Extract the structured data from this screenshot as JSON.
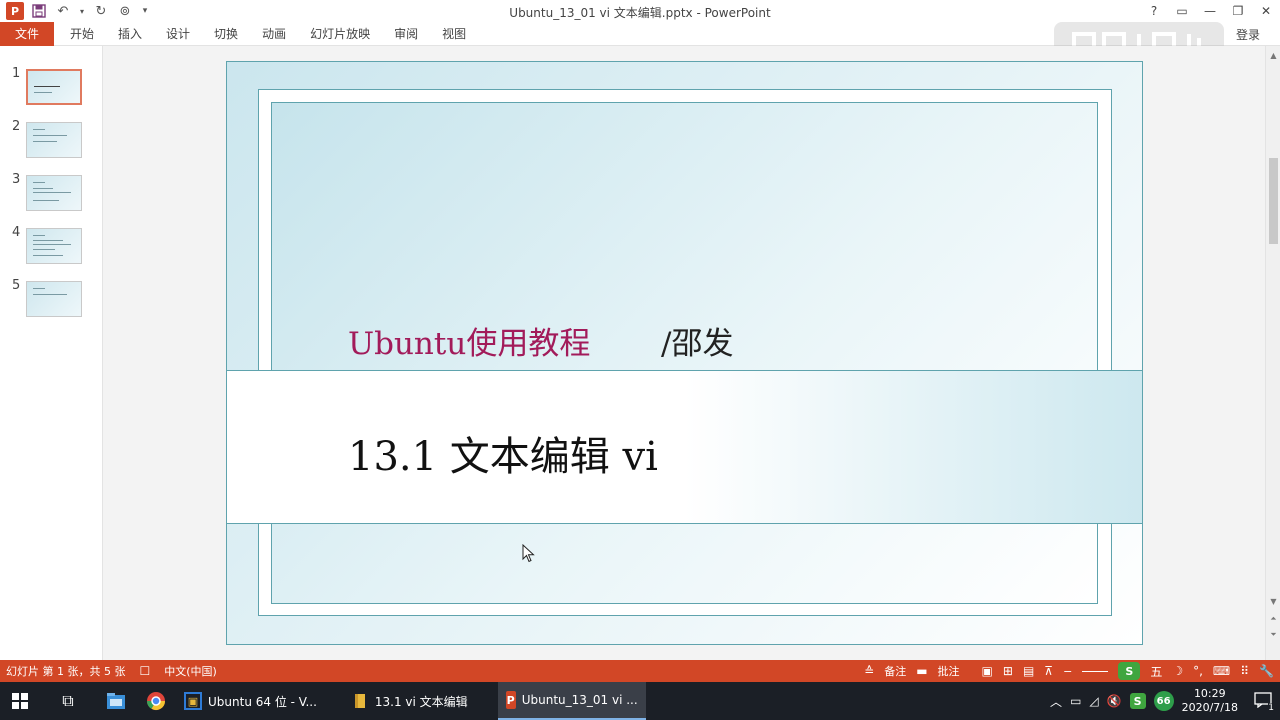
{
  "window": {
    "title": "Ubuntu_13_01 vi 文本编辑.pptx - PowerPoint",
    "login": "登录",
    "controls": [
      "?",
      "▭",
      "—",
      "❐",
      "✕"
    ]
  },
  "ribbon": {
    "file_tab": "文件",
    "tabs": [
      "开始",
      "插入",
      "设计",
      "切换",
      "动画",
      "幻灯片放映",
      "审阅",
      "视图"
    ]
  },
  "thumbnails": [
    {
      "number": "1",
      "selected": true
    },
    {
      "number": "2",
      "selected": false
    },
    {
      "number": "3",
      "selected": false
    },
    {
      "number": "4",
      "selected": false
    },
    {
      "number": "5",
      "selected": false
    }
  ],
  "slide": {
    "subtitle": "Ubuntu使用教程",
    "author": "/邵发",
    "title": "13.1 文本编辑 vi"
  },
  "statusbar": {
    "slide_info": "幻灯片 第 1 张，共 5 张",
    "language": "中文(中国)",
    "notes": "备注",
    "comments": "批注"
  },
  "taskbar": {
    "apps": [
      {
        "label": "Ubuntu 64 位 - V...",
        "icon": "VM",
        "color": "#2e7bd6",
        "active": false
      },
      {
        "label": "13.1 vi 文本编辑",
        "icon": "📁",
        "color": "#e8b83c",
        "active": false
      },
      {
        "label": "Ubuntu_13_01 vi ...",
        "icon": "P",
        "color": "#d24726",
        "active": true
      }
    ],
    "tray_badge": "66",
    "time": "10:29",
    "date": "2020/7/18",
    "notification_count": "1"
  },
  "colors": {
    "accent": "#d24726",
    "slide_border": "#5fa3ad",
    "subtitle": "#a21b5a"
  }
}
